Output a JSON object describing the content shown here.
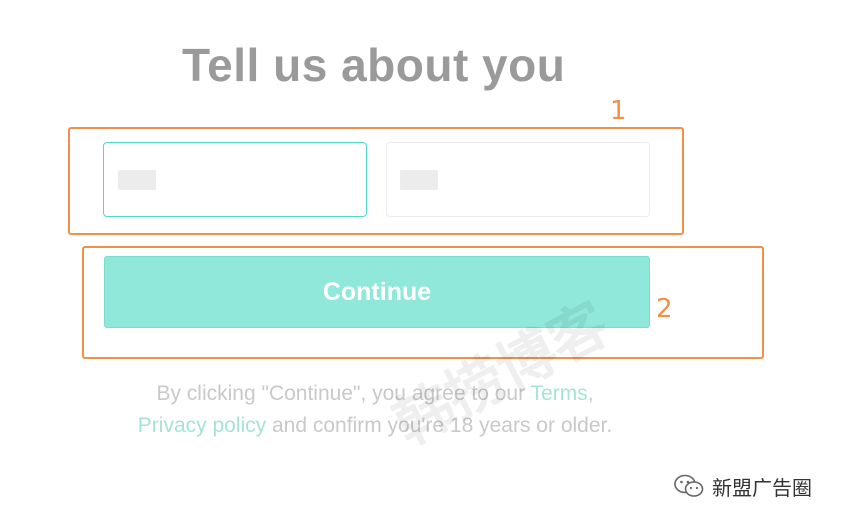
{
  "header": {
    "title": "Tell us about you"
  },
  "annotations": {
    "label_1": "1",
    "label_2": "2"
  },
  "form": {
    "first_name": {
      "value": "",
      "placeholder": ""
    },
    "last_name": {
      "value": "",
      "placeholder": ""
    },
    "continue_label": "Continue"
  },
  "legal": {
    "prefix": "By clicking \"Continue\", you agree to our ",
    "terms_link": "Terms",
    "comma": ",",
    "privacy_link": "Privacy policy",
    "suffix": " and confirm you're 18 years or older."
  },
  "watermark": {
    "text": "韩捞博客"
  },
  "footer": {
    "channel_name": "新盟广告圈",
    "icon": "wechat-icon"
  },
  "colors": {
    "accent": "#4fd9c6",
    "button": "#8fe8da",
    "annotation": "#f0904a",
    "title": "#9a9a9a"
  }
}
